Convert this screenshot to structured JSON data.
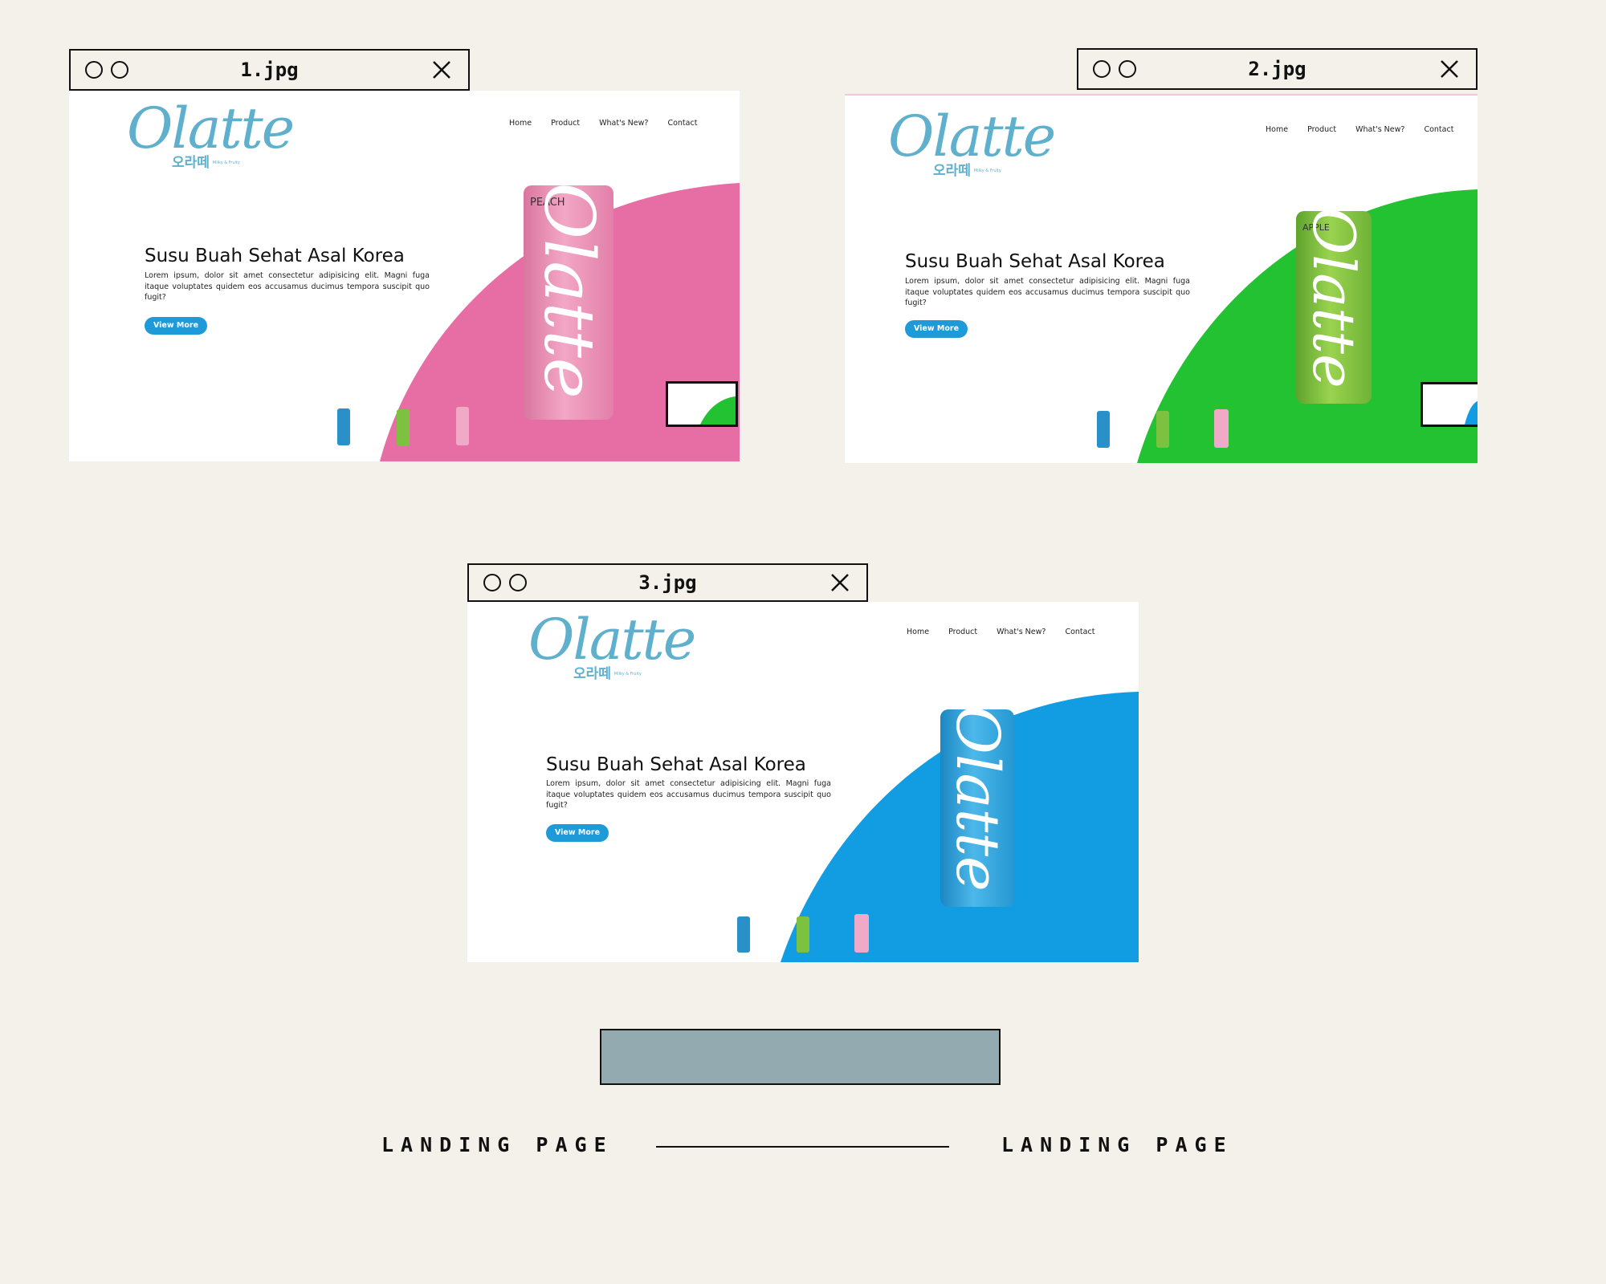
{
  "windows": [
    {
      "title": "1.jpg",
      "accent": "#e66ea4",
      "flavor": "PEACH",
      "can_color": "#ee8fb5",
      "site": {
        "logo_text": "Olatte",
        "logo_korean": "오라떼",
        "logo_tagline": "Milky & Fruity",
        "nav": [
          "Home",
          "Product",
          "What's New?",
          "Contact"
        ],
        "heading": "Susu Buah Sehat Asal Korea",
        "paragraph": "Lorem ipsum, dolor sit amet consectetur adipisicing elit. Magni fuga itaque voluptates quidem eos accusamus ducimus tempora suscipit quo fugit?",
        "button": "View More"
      }
    },
    {
      "title": "2.jpg",
      "accent": "#22c232",
      "flavor": "APPLE",
      "can_color": "#7cc240",
      "site": {
        "logo_text": "Olatte",
        "logo_korean": "오라떼",
        "logo_tagline": "Milky & Fruity",
        "nav": [
          "Home",
          "Product",
          "What's New?",
          "Contact"
        ],
        "heading": "Susu Buah Sehat Asal Korea",
        "paragraph": "Lorem ipsum, dolor sit amet consectetur adipisicing elit. Magni fuga itaque voluptates quidem eos accusamus ducimus tempora suscipit quo fugit?",
        "button": "View More"
      }
    },
    {
      "title": "3.jpg",
      "accent": "#129de3",
      "flavor": "",
      "can_color": "#2aa3dc",
      "site": {
        "logo_text": "Olatte",
        "logo_korean": "오라떼",
        "logo_tagline": "Milky & Fruity",
        "nav": [
          "Home",
          "Product",
          "What's New?",
          "Contact"
        ],
        "heading": "Susu Buah Sehat Asal Korea",
        "paragraph": "Lorem ipsum, dolor sit amet consectetur adipisicing elit. Magni fuga itaque voluptates quidem eos accusamus ducimus tempora suscipit quo fugit?",
        "button": "View More"
      }
    }
  ],
  "captions": {
    "left": "LANDING PAGE",
    "right": "LANDING PAGE"
  },
  "colors": {
    "background": "#f4f0ea",
    "slate": "#92aab0",
    "brand": "#5fb0cc",
    "button": "#1f9ad8"
  }
}
